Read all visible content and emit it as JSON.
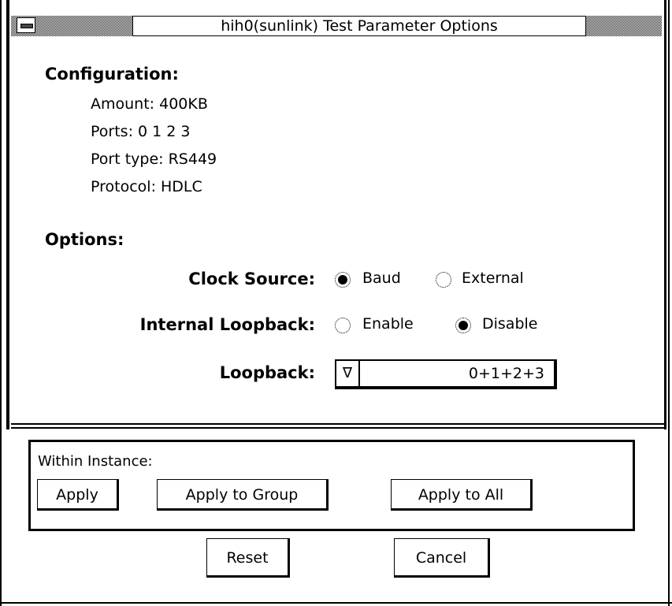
{
  "window": {
    "title": "hih0(sunlink) Test Parameter Options"
  },
  "configuration": {
    "heading": "Configuration:",
    "amount": "Amount: 400KB",
    "ports": "Ports: 0 1 2 3",
    "port_type": "Port type: RS449",
    "protocol": "Protocol: HDLC"
  },
  "options": {
    "heading": "Options:",
    "clock_source": {
      "label": "Clock Source:",
      "choices": [
        {
          "label": "Baud",
          "selected": true
        },
        {
          "label": "External",
          "selected": false
        }
      ]
    },
    "internal_loopback": {
      "label": "Internal Loopback:",
      "choices": [
        {
          "label": "Enable",
          "selected": false
        },
        {
          "label": "Disable",
          "selected": true
        }
      ]
    },
    "loopback": {
      "label": "Loopback:",
      "value": "0+1+2+3",
      "arrow": "∇"
    }
  },
  "within_instance": {
    "label": "Within Instance:",
    "apply": "Apply",
    "apply_group": "Apply to Group",
    "apply_all": "Apply to All"
  },
  "footer": {
    "reset": "Reset",
    "cancel": "Cancel"
  }
}
